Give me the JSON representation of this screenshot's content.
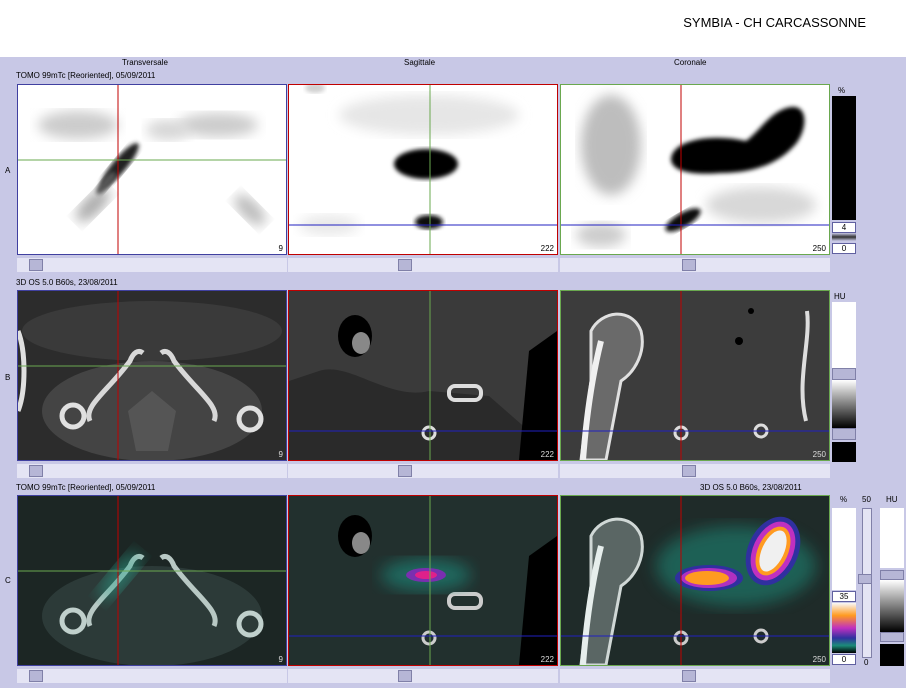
{
  "header": {
    "title": "SYMBIA - CH CARCASSONNE"
  },
  "columns": [
    "Transversale",
    "Sagittale",
    "Coronale"
  ],
  "rows": {
    "a": {
      "label": "A",
      "series": "TOMO 99mTc [Reoriented], 05/09/2011",
      "slices": [
        "9",
        "222",
        "250"
      ]
    },
    "b": {
      "label": "B",
      "series": "3D  OS  5.0  B60s, 23/08/2011",
      "slices": [
        "9",
        "222",
        "250"
      ]
    },
    "c": {
      "label": "C",
      "series_left": "TOMO 99mTc [Reoriented], 05/09/2011",
      "series_right": "3D  OS  5.0  B60s, 23/08/2011",
      "slices": [
        "9",
        "222",
        "250"
      ]
    }
  },
  "colorbars": {
    "a": {
      "unit": "%",
      "value": "4",
      "min": "0"
    },
    "b": {
      "unit": "HU"
    },
    "c": {
      "unit_pct": "%",
      "unit_fifty": "50",
      "unit_hu": "HU",
      "value": "35",
      "min": "0",
      "min_hu": "0"
    }
  },
  "colors": {
    "transverse": "#c00000",
    "sagittal": "#6aa84f",
    "coronal": "#2020c0",
    "panel_bg": "#c8c8e6"
  }
}
